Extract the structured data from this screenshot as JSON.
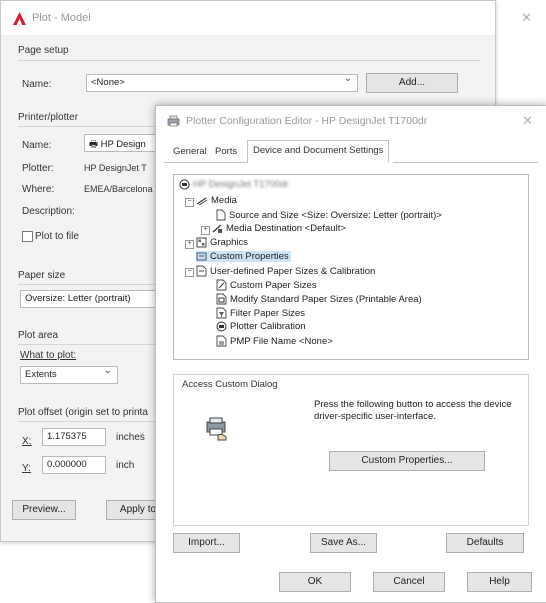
{
  "plot_dialog": {
    "title": "Plot - Model",
    "page_setup_label": "Page setup",
    "name_label": "Name:",
    "page_setup_value": "<None>",
    "add_button": "Add...",
    "printer_plotter_label": "Printer/plotter",
    "printer_name_label": "Name:",
    "printer_name_value": "HP Design",
    "plotter_label": "Plotter:",
    "plotter_value": "HP DesignJet T",
    "where_label": "Where:",
    "where_value": "EMEA/Barcelona",
    "description_label": "Description:",
    "plot_to_file_label": "Plot to file",
    "paper_size_label": "Paper size",
    "paper_size_value": "Oversize: Letter (portrait)",
    "plot_area_label": "Plot area",
    "what_to_plot_label": "What to plot:",
    "what_to_plot_value": "Extents",
    "plot_offset_label": "Plot offset (origin set to printa",
    "x_label": "X:",
    "x_value": "1.175375",
    "x_unit": "inches",
    "y_label": "Y:",
    "y_value": "0.000000",
    "y_unit": "inch",
    "preview_button": "Preview...",
    "apply_button": "Apply to"
  },
  "config_dialog": {
    "title": "Plotter Configuration Editor - HP DesignJet T1700dr",
    "tabs": [
      "General",
      "Ports",
      "Device and Document Settings"
    ],
    "active_tab": 2,
    "tree": {
      "root": "HP DesignJet T1700dr",
      "media": "Media",
      "source_size": "Source and Size <Size: Oversize: Letter (portrait)>",
      "media_destination": "Media Destination <Default>",
      "graphics": "Graphics",
      "custom_properties": "Custom Properties",
      "user_defined": "User-defined Paper Sizes & Calibration",
      "custom_paper_sizes": "Custom Paper Sizes",
      "modify_standard": "Modify Standard Paper Sizes (Printable Area)",
      "filter_paper": "Filter Paper Sizes",
      "plotter_calibration": "Plotter Calibration",
      "pmp_file": "PMP File Name <None>"
    },
    "access_custom_dialog_label": "Access Custom Dialog",
    "access_text": "Press the following button to access the device driver-specific user-interface.",
    "custom_properties_button": "Custom Properties...",
    "import_button": "Import...",
    "save_as_button": "Save As...",
    "defaults_button": "Defaults",
    "ok_button": "OK",
    "cancel_button": "Cancel",
    "help_button": "Help"
  },
  "colors": {
    "autocad_red": "#d4202a",
    "selection": "#cde3f7"
  }
}
